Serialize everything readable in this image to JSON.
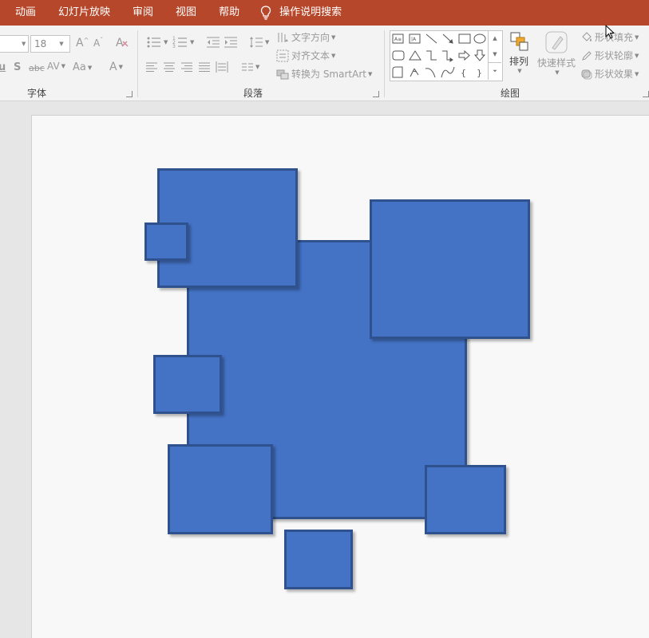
{
  "menu": {
    "items": [
      "动画",
      "幻灯片放映",
      "审阅",
      "视图",
      "帮助"
    ],
    "tell_me": "操作说明搜索"
  },
  "ribbon": {
    "font_group": {
      "label": "字体",
      "font_size": "18",
      "grow_font": "A",
      "shrink_font": "A",
      "shadow": "S",
      "strikethrough": "abc",
      "char_spacing": "AV",
      "change_case": "Aa",
      "font_color": "A"
    },
    "paragraph_group": {
      "label": "段落",
      "text_direction": "文字方向",
      "align_text": "对齐文本",
      "convert_smartart": "转换为 SmartArt"
    },
    "drawing_group": {
      "label": "绘图",
      "arrange": "排列",
      "quick_styles": "快速样式",
      "shape_fill": "形状填充",
      "shape_outline": "形状轮廓",
      "shape_effects": "形状效果"
    }
  },
  "colors": {
    "menubar": "#b7472a",
    "shape_fill": "#4472c4",
    "shape_outline": "#2f528f"
  }
}
